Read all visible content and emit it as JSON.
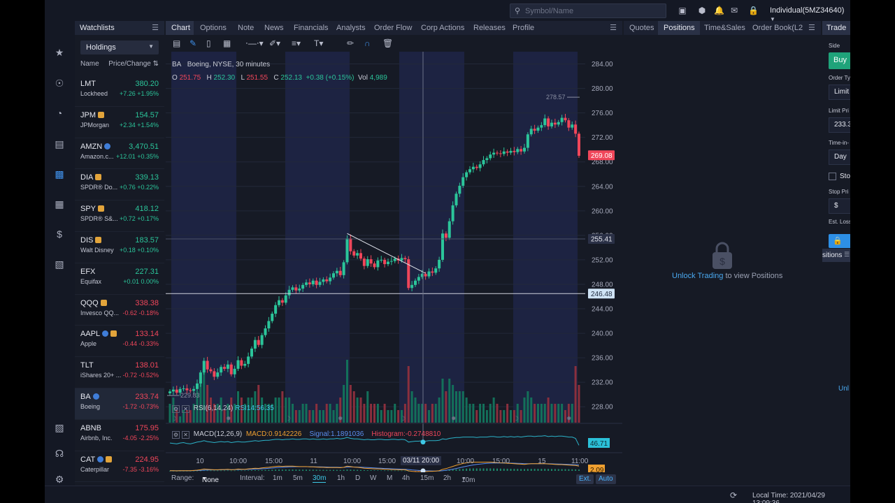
{
  "topbar": {
    "search_placeholder": "Symbol/Name",
    "account": "Individual(5MZ34640)",
    "icons": [
      "save-icon",
      "cube-icon",
      "bell-icon",
      "mail-icon",
      "lock-icon"
    ]
  },
  "rail": {
    "icons": [
      "star-icon",
      "globe-icon",
      "gauge-icon",
      "paint-roller-icon",
      "chart-bars-icon",
      "wallet-icon",
      "dollar-icon",
      "report-icon",
      "book-icon",
      "headset-icon",
      "gear-icon"
    ]
  },
  "watchlist": {
    "tab": "Watchlists",
    "selected_list": "Holdings",
    "col_name": "Name",
    "col_price": "Price/Change",
    "items": [
      {
        "symbol": "LMT",
        "name": "Lockheed",
        "price": "380.20",
        "change": "+7.26 +1.95%",
        "dir": "up",
        "badges": []
      },
      {
        "symbol": "JPM",
        "name": "JPMorgan",
        "price": "154.57",
        "change": "+2.34 +1.54%",
        "dir": "up",
        "badges": [
          "e"
        ]
      },
      {
        "symbol": "AMZN",
        "name": "Amazon.c...",
        "price": "3,470.51",
        "change": "+12.01 +0.35%",
        "dir": "up",
        "badges": [
          "i"
        ]
      },
      {
        "symbol": "DIA",
        "name": "SPDR® Do...",
        "price": "339.13",
        "change": "+0.76 +0.22%",
        "dir": "up",
        "badges": [
          "e"
        ]
      },
      {
        "symbol": "SPY",
        "name": "SPDR® S&...",
        "price": "418.12",
        "change": "+0.72 +0.17%",
        "dir": "up",
        "badges": [
          "e"
        ]
      },
      {
        "symbol": "DIS",
        "name": "Walt Disney",
        "price": "183.57",
        "change": "+0.18 +0.10%",
        "dir": "up",
        "badges": [
          "e"
        ]
      },
      {
        "symbol": "EFX",
        "name": "Equifax",
        "price": "227.31",
        "change": "+0.01 0.00%",
        "dir": "up",
        "badges": []
      },
      {
        "symbol": "QQQ",
        "name": "Invesco QQ...",
        "price": "338.38",
        "change": "-0.62 -0.18%",
        "dir": "dn",
        "badges": [
          "e"
        ]
      },
      {
        "symbol": "AAPL",
        "name": "Apple",
        "price": "133.14",
        "change": "-0.44 -0.33%",
        "dir": "dn",
        "badges": [
          "i",
          "e"
        ]
      },
      {
        "symbol": "TLT",
        "name": "iShares 20+ ...",
        "price": "138.01",
        "change": "-0.72 -0.52%",
        "dir": "dn",
        "badges": []
      },
      {
        "symbol": "BA",
        "name": "Boeing",
        "price": "233.74",
        "change": "-1.72 -0.73%",
        "dir": "dn",
        "badges": [
          "i"
        ],
        "selected": true
      },
      {
        "symbol": "ABNB",
        "name": "Airbnb, Inc.",
        "price": "175.95",
        "change": "-4.05 -2.25%",
        "dir": "dn",
        "badges": []
      },
      {
        "symbol": "CAT",
        "name": "Caterpillar",
        "price": "224.95",
        "change": "-7.35 -3.16%",
        "dir": "dn",
        "badges": [
          "i",
          "e"
        ]
      }
    ]
  },
  "chart_panel": {
    "tabs": [
      "Chart",
      "Options",
      "Note",
      "News",
      "Financials",
      "Analysts",
      "Order Flow",
      "Corp Actions",
      "Releases",
      "Profile"
    ],
    "active_tab": "Chart",
    "legend": {
      "symbol": "BA",
      "desc": "Boeing, NYSE, 30 minutes"
    },
    "ohlc": {
      "o_label": "O",
      "o": "251.75",
      "h_label": "H",
      "h": "252.30",
      "l_label": "L",
      "l": "251.55",
      "c_label": "C",
      "c": "252.13",
      "chg": "+0.38 (+0.15%)",
      "vol_label": "Vol",
      "vol": "4,989"
    },
    "rsi": {
      "name": "RSI(6,14,24)",
      "value": "RSI14:56.35",
      "last": "46.71"
    },
    "macd": {
      "name": "MACD(12,26,9)",
      "macd": "MACD:0.9142226",
      "signal": "Signal:1.1891036",
      "hist": "Histogram:-0.2748810",
      "last": "2.09"
    },
    "range": {
      "range_label": "Range:",
      "range_value": "None",
      "interval_label": "Interval:",
      "intervals": [
        "1m",
        "5m",
        "30m",
        "1h",
        "D",
        "W",
        "M",
        "4h",
        "15m",
        "2h",
        "10m"
      ],
      "active_interval": "30m",
      "ext": "Ext.",
      "auto": "Auto"
    }
  },
  "chart_data": {
    "type": "candlestick",
    "symbol": "BA",
    "yticks": [
      228,
      232,
      236,
      240,
      244,
      248,
      252,
      256,
      260,
      264,
      268,
      272,
      276,
      280,
      284
    ],
    "ylim": [
      225.4,
      286.0
    ],
    "xticks": [
      "10",
      "10:00",
      "15:00",
      "11",
      "10:00",
      "15:00",
      "03/11 20:00",
      "10:00",
      "15:00",
      "15",
      "11:00"
    ],
    "price_labels": {
      "high_marker": "278.57",
      "low_marker": "229.83",
      "last": "269.08",
      "line1": "255.41",
      "line2": "246.48"
    },
    "closes": [
      230.5,
      230.8,
      230.3,
      230.9,
      231.0,
      230.7,
      230.6,
      230.9,
      231.8,
      233.6,
      235.5,
      234.1,
      233.8,
      232.9,
      233.6,
      234.5,
      234.2,
      234.9,
      233.3,
      234.2,
      235.6,
      234.7,
      235.0,
      236.2,
      237.5,
      238.9,
      238.1,
      239.7,
      240.8,
      242.0,
      243.2,
      244.6,
      245.4,
      245.0,
      246.2,
      247.1,
      247.5,
      247.0,
      247.3,
      247.9,
      248.3,
      248.0,
      248.6,
      247.9,
      248.4,
      248.8,
      248.5,
      249.1,
      249.8,
      250.2,
      249.5,
      251.6,
      255.5,
      253.4,
      252.7,
      253.1,
      252.2,
      251.0,
      252.1,
      251.4,
      250.8,
      251.9,
      252.0,
      251.3,
      251.7,
      251.8,
      252.2,
      251.9,
      252.3,
      252.1,
      247.4,
      247.9,
      248.6,
      249.2,
      249.7,
      249.3,
      250.1,
      249.9,
      250.6,
      252.0,
      256.3,
      255.6,
      258.3,
      260.9,
      262.8,
      264.1,
      265.5,
      266.3,
      266.8,
      267.2,
      267.0,
      267.6,
      268.3,
      268.6,
      269.2,
      269.5,
      269.4,
      269.3,
      269.7,
      269.5,
      269.8,
      269.6,
      270.1,
      269.7,
      270.3,
      272.5,
      273.4,
      273.1,
      273.6,
      274.0,
      275.1,
      273.8,
      274.4,
      274.1,
      274.5,
      275.2,
      274.8,
      273.6,
      274.1,
      272.6,
      269.0
    ],
    "rsi": [
      52,
      51,
      50,
      52,
      53,
      51,
      50,
      52,
      54,
      55,
      57,
      55,
      54,
      53,
      54,
      55,
      54,
      55,
      53,
      54,
      55,
      54,
      54,
      55,
      56,
      57,
      56,
      57,
      58,
      58,
      59,
      60,
      60,
      59,
      60,
      60,
      61,
      60,
      60,
      61,
      61,
      60,
      61,
      60,
      60,
      61,
      60,
      61,
      61,
      62,
      61,
      62,
      64,
      62,
      61,
      61,
      60,
      59,
      60,
      59,
      59,
      60,
      60,
      59,
      59,
      60,
      60,
      59,
      60,
      59,
      54,
      55,
      56,
      56,
      57,
      56,
      57,
      57,
      57,
      58,
      61,
      60,
      62,
      63,
      64,
      64,
      65,
      65,
      65,
      65,
      64,
      65,
      65,
      65,
      66,
      66,
      65,
      65,
      66,
      65,
      66,
      65,
      66,
      65,
      66,
      67,
      67,
      66,
      67,
      67,
      68,
      66,
      67,
      66,
      67,
      67,
      66,
      65,
      65,
      62,
      47
    ],
    "macd": [
      0.1,
      0.1,
      0.0,
      0.1,
      0.1,
      0.1,
      0.1,
      0.2,
      0.3,
      0.5,
      0.8,
      0.7,
      0.6,
      0.5,
      0.5,
      0.6,
      0.6,
      0.7,
      0.5,
      0.6,
      0.8,
      0.7,
      0.7,
      0.9,
      1.0,
      1.2,
      1.1,
      1.3,
      1.5,
      1.6,
      1.8,
      2.0,
      2.1,
      2.0,
      2.1,
      2.1,
      2.1,
      2.0,
      1.9,
      1.9,
      1.9,
      1.8,
      1.8,
      1.7,
      1.6,
      1.6,
      1.5,
      1.5,
      1.5,
      1.5,
      1.4,
      1.6,
      2.1,
      1.9,
      1.7,
      1.6,
      1.4,
      1.2,
      1.1,
      1.0,
      0.9,
      0.9,
      0.8,
      0.7,
      0.7,
      0.6,
      0.6,
      0.5,
      0.5,
      0.5,
      0.0,
      -0.2,
      -0.3,
      -0.3,
      -0.3,
      -0.3,
      -0.2,
      -0.2,
      -0.1,
      0.1,
      0.7,
      1.0,
      1.5,
      2.0,
      2.5,
      2.9,
      3.3,
      3.6,
      3.8,
      3.9,
      3.9,
      3.9,
      3.9,
      3.9,
      3.9,
      3.8,
      3.7,
      3.6,
      3.5,
      3.4,
      3.3,
      3.2,
      3.1,
      3.0,
      2.9,
      3.1,
      3.2,
      3.2,
      3.2,
      3.2,
      3.2,
      3.1,
      3.0,
      2.9,
      2.8,
      2.8,
      2.7,
      2.6,
      2.5,
      2.4,
      2.1
    ],
    "volume": [
      0.3,
      0.4,
      0.2,
      0.1,
      0.2,
      0.2,
      0.2,
      0.3,
      0.5,
      0.7,
      0.9,
      0.6,
      0.4,
      0.3,
      0.3,
      0.4,
      0.2,
      0.3,
      0.4,
      0.3,
      0.5,
      0.4,
      0.3,
      0.4,
      0.4,
      0.5,
      0.6,
      0.4,
      0.3,
      0.3,
      0.3,
      0.4,
      0.4,
      0.5,
      0.4,
      0.4,
      0.3,
      0.2,
      0.2,
      0.3,
      0.3,
      0.2,
      0.2,
      0.3,
      0.2,
      0.2,
      0.3,
      0.3,
      0.2,
      0.3,
      0.4,
      0.6,
      1.0,
      0.6,
      0.5,
      0.4,
      0.4,
      0.3,
      0.5,
      0.3,
      0.3,
      0.3,
      0.2,
      0.3,
      0.2,
      0.2,
      0.3,
      0.2,
      0.2,
      0.3,
      0.9,
      0.5,
      0.4,
      0.3,
      0.3,
      0.3,
      0.2,
      0.3,
      0.3,
      0.4,
      0.7,
      0.5,
      0.7,
      0.6,
      0.5,
      0.5,
      0.5,
      0.4,
      0.3,
      0.3,
      0.2,
      0.3,
      0.3,
      0.2,
      0.3,
      0.4,
      0.3,
      0.2,
      0.2,
      0.3,
      0.2,
      0.2,
      0.3,
      0.2,
      0.4,
      0.5,
      0.4,
      0.3,
      0.3,
      0.3,
      0.3,
      0.4,
      0.3,
      0.3,
      0.3,
      0.3,
      0.2,
      0.3,
      0.3,
      0.9,
      0.6
    ]
  },
  "positions_panel": {
    "tabs": [
      "Quotes",
      "Positions",
      "Time&Sales",
      "Order Book(L2"
    ],
    "active_tab": "Positions",
    "unlock_link": "Unlock Trading",
    "unlock_text": "to view Positions"
  },
  "trade_panel": {
    "tab": "Trade",
    "side_label": "Side",
    "buy": "Buy",
    "order_type_label": "Order Ty",
    "order_type": "Limit",
    "limit_price_label": "Limit Pri",
    "limit_price": "233.3",
    "tif_label": "Time-in-",
    "tif": "Day",
    "stop_checkbox": "Sto",
    "stop_price_label": "Stop Pri",
    "stop_price": "$",
    "est_loss_label": "Est. Loss",
    "positions_tab": "sitions",
    "unlock_cut": "Unl"
  },
  "status": {
    "local_time": "Local Time: 2021/04/29 13:09:36"
  }
}
